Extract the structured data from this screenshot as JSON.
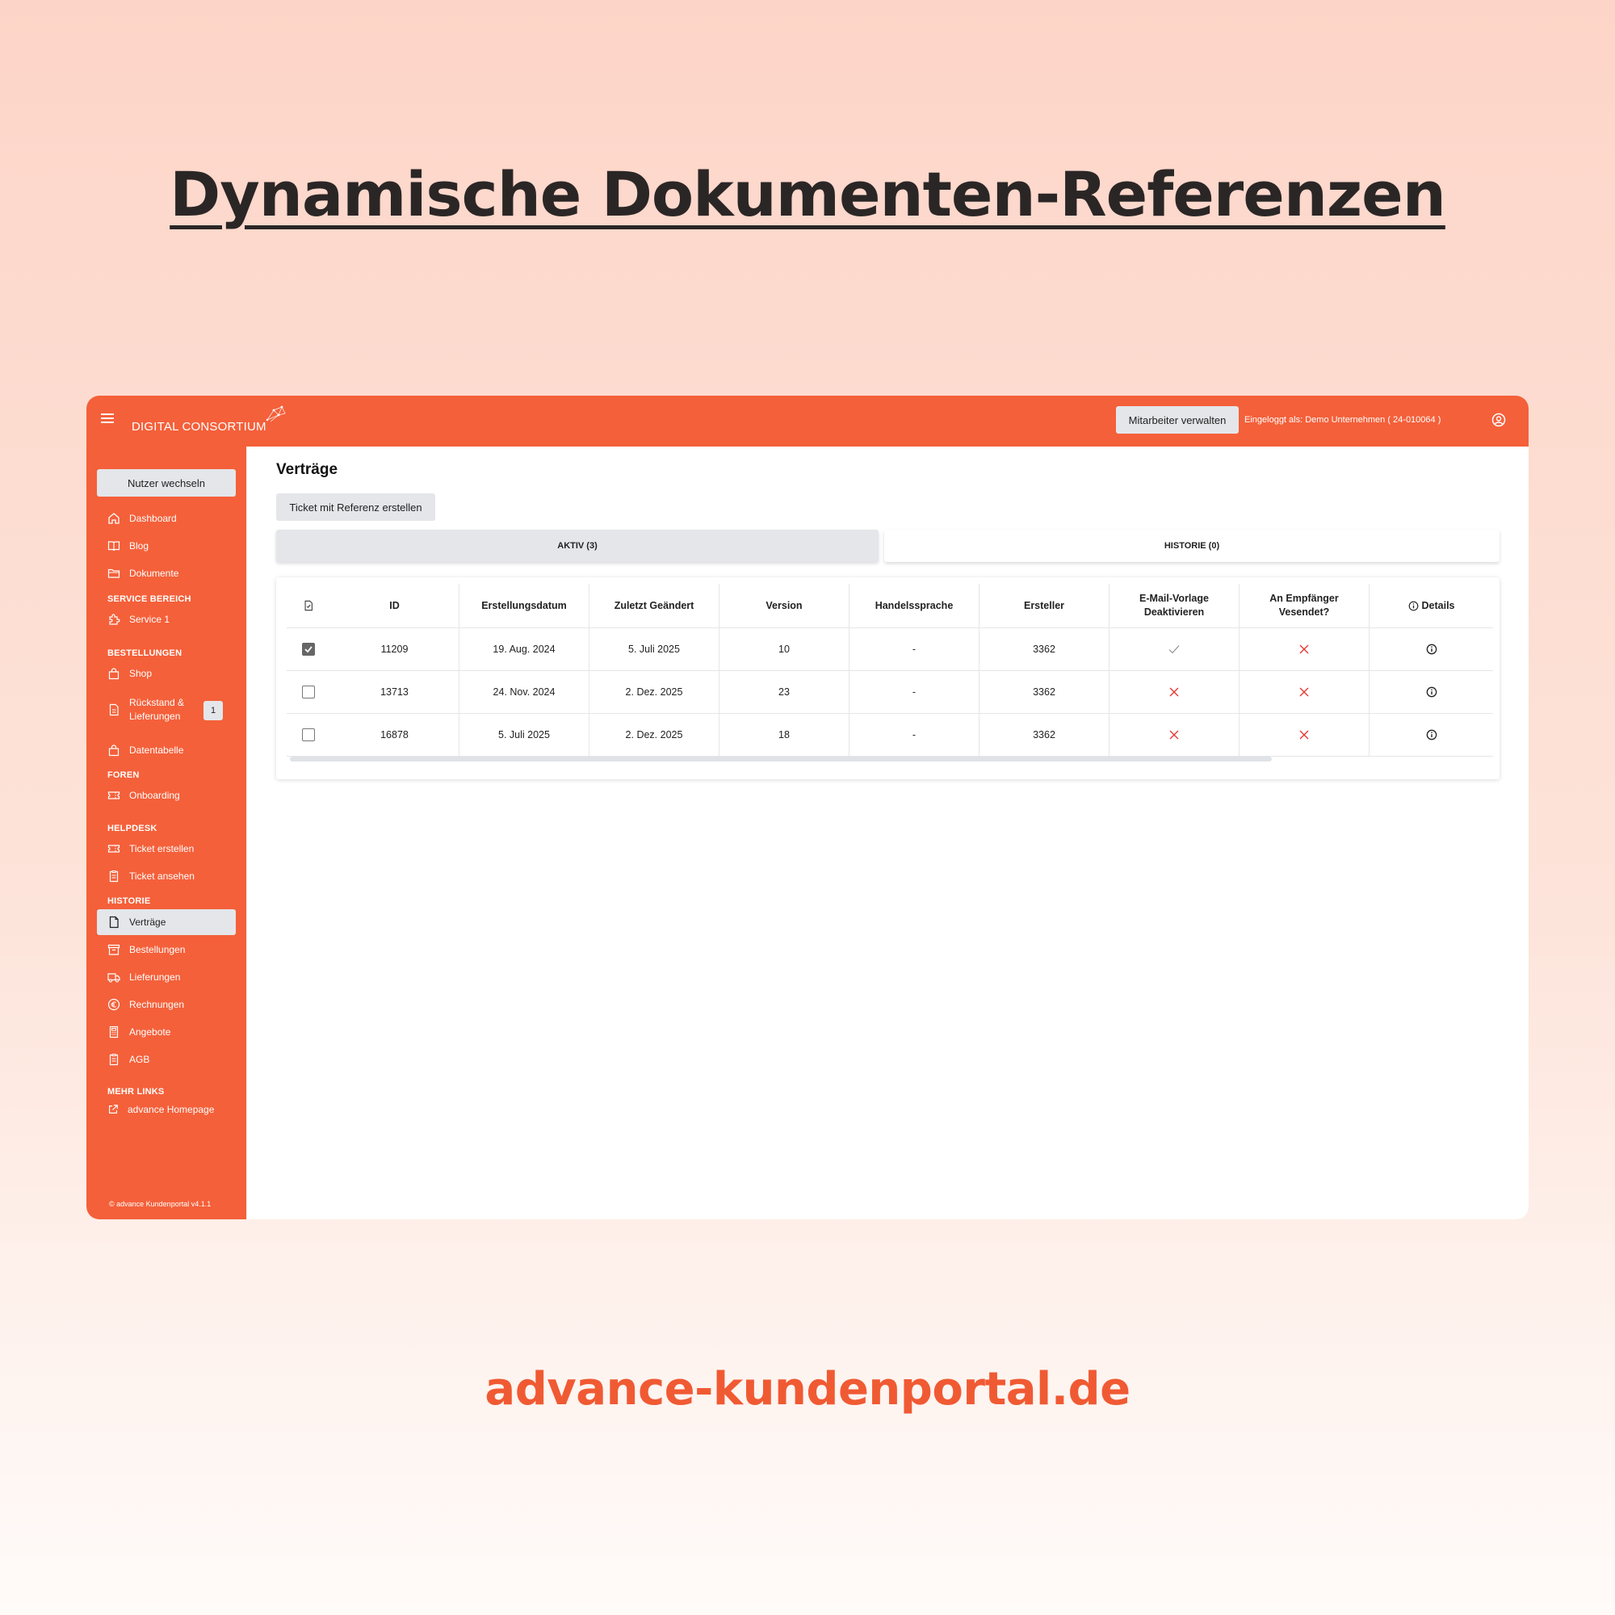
{
  "hero": {
    "title": "Dynamische Dokumenten-Referenzen",
    "footer_url": "advance-kundenportal.de"
  },
  "colors": {
    "accent": "#f4603a",
    "neutral_button": "#e4e6ea",
    "error": "#e53935"
  },
  "topbar": {
    "brand": "DIGITAL CONSORTIUM",
    "manage_button": "Mitarbeiter verwalten",
    "login_info": "Eingeloggt als: Demo Unternehmen ( 24-010064 )",
    "user_icon": "user-circle-icon",
    "menu_icon": "hamburger-icon"
  },
  "sidebar": {
    "switch_user": "Nutzer wechseln",
    "items_top": [
      {
        "label": "Dashboard",
        "icon": "home-icon"
      },
      {
        "label": "Blog",
        "icon": "book-icon"
      },
      {
        "label": "Dokumente",
        "icon": "folder-icon"
      }
    ],
    "sections": [
      {
        "title": "SERVICE BEREICH",
        "items": [
          {
            "label": "Service 1",
            "icon": "puzzle-icon"
          }
        ]
      },
      {
        "title": "BESTELLUNGEN",
        "items": [
          {
            "label": "Shop",
            "icon": "shopping-bag-icon"
          },
          {
            "label_line1": "Rückstand &",
            "label_line2": "Lieferungen",
            "icon": "document-icon",
            "badge": "1"
          },
          {
            "label": "Datentabelle",
            "icon": "shopping-bag-icon"
          }
        ]
      },
      {
        "title": "FOREN",
        "items": [
          {
            "label": "Onboarding",
            "icon": "ticket-icon"
          }
        ]
      },
      {
        "title": "HELPDESK",
        "items": [
          {
            "label": "Ticket erstellen",
            "icon": "ticket-icon"
          },
          {
            "label": "Ticket ansehen",
            "icon": "clipboard-icon"
          }
        ]
      },
      {
        "title": "HISTORIE",
        "items": [
          {
            "label": "Verträge",
            "icon": "file-icon",
            "active": true
          },
          {
            "label": "Bestellungen",
            "icon": "archive-icon"
          },
          {
            "label": "Lieferungen",
            "icon": "truck-icon"
          },
          {
            "label": "Rechnungen",
            "icon": "euro-icon"
          },
          {
            "label": "Angebote",
            "icon": "calculator-icon"
          },
          {
            "label": "AGB",
            "icon": "clipboard-icon"
          }
        ]
      },
      {
        "title": "MEHR LINKS",
        "items": [
          {
            "label": "advance Homepage",
            "icon": "external-link-icon"
          }
        ]
      }
    ],
    "copyright": "© advance Kundenportal v4.1.1"
  },
  "main": {
    "title": "Verträge",
    "ticket_button": "Ticket mit Referenz erstellen",
    "tabs": [
      {
        "label": "AKTIV (3)",
        "active": true
      },
      {
        "label": "HISTORIE (0)",
        "active": false
      }
    ],
    "table": {
      "headers": [
        "ID",
        "Erstellungsdatum",
        "Zuletzt Geändert",
        "Version",
        "Handelssprache",
        "Ersteller",
        "E-Mail-Vorlage Deaktivieren",
        "An Empfänger Vesendet?",
        "Details"
      ],
      "header_split": {
        "email_line1": "E-Mail-Vorlage",
        "email_line2": "Deaktivieren",
        "sent_line1": "An Empfänger",
        "sent_line2": "Vesendet?"
      },
      "rows": [
        {
          "checked": true,
          "id": "11209",
          "created": "19. Aug. 2024",
          "changed": "5. Juli 2025",
          "version": "10",
          "language": "-",
          "creator": "3362",
          "email_disabled": "check",
          "sent": "cross"
        },
        {
          "checked": false,
          "id": "13713",
          "created": "24. Nov. 2024",
          "changed": "2. Dez. 2025",
          "version": "23",
          "language": "-",
          "creator": "3362",
          "email_disabled": "cross",
          "sent": "cross"
        },
        {
          "checked": false,
          "id": "16878",
          "created": "5. Juli 2025",
          "changed": "2. Dez. 2025",
          "version": "18",
          "language": "-",
          "creator": "3362",
          "email_disabled": "cross",
          "sent": "cross"
        }
      ]
    }
  }
}
